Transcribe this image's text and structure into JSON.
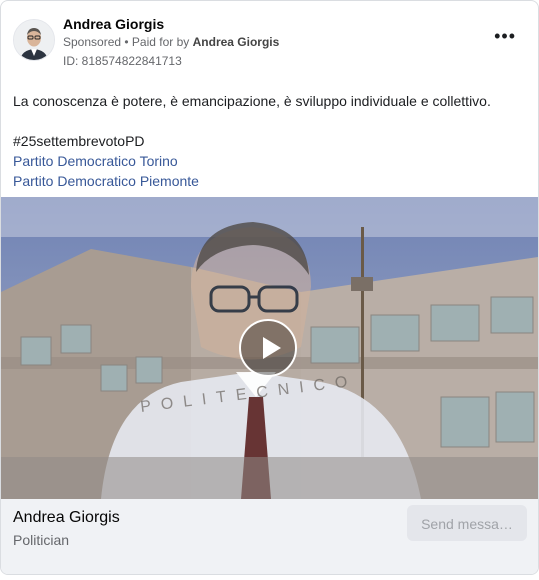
{
  "post": {
    "page_name": "Andrea Giorgis",
    "sponsored_label": "Sponsored",
    "paid_for_prefix": " • Paid for by ",
    "paid_for_by": "Andrea Giorgis",
    "ad_id": "ID: 818574822841713",
    "more_icon": "more-options-icon"
  },
  "body": {
    "text": "La conoscenza è potere, è emancipazione, è sviluppo individuale e collettivo.",
    "hashtag": "#25settembrevotoPD",
    "tag1": "Partito Democratico Torino",
    "tag2": "Partito Democratico Piemonte"
  },
  "media": {
    "type": "video",
    "building_sign": "POLITECNICO"
  },
  "footer": {
    "page_name": "Andrea Giorgis",
    "category": "Politician",
    "cta_label": "Send messa…"
  },
  "colors": {
    "link": "#385898",
    "footer_bg": "#f0f2f5",
    "cta_bg": "#e4e6eb"
  }
}
